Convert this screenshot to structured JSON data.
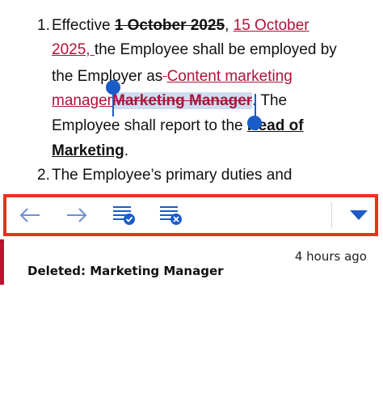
{
  "document": {
    "item1_number": "1.",
    "item1_line1_a": "Effective ",
    "item1_line1_deleted": "1 October 2025",
    "item1_line1_b": ", ",
    "item1_line1_inserted": "15 October",
    "item1_line2_inserted": "2025, ",
    "item1_line2_text": "the Employee shall be employed by",
    "item1_line3_text": "the Employer as",
    "item1_line3_deleted_space": " ",
    "item1_line3_inserted": " Content marketing",
    "item1_line4_inserted": "manager",
    "item1_line4_selected_deleted": "Marketing Manager",
    "item1_line4_text": ". The",
    "item1_line5_text": "Employee shall report to the ",
    "item1_line5_bold": "Head of",
    "item1_line6_bold": "Marketing",
    "item1_line6_text": ".",
    "item2_number": "2.",
    "item2_line1_text": "The Employee’s primary duties and"
  },
  "toolbar": {
    "icons": [
      "previous-change-icon",
      "next-change-icon",
      "accept-change-icon",
      "reject-change-icon",
      "expand-dropdown-icon"
    ],
    "accent_color": "#1a5cc8",
    "highlight_border_color": "#e8321e"
  },
  "comment_panel": {
    "timestamp": "4 hours ago",
    "change_description": "Deleted: Marketing Manager",
    "marker_color": "#c0122f"
  }
}
